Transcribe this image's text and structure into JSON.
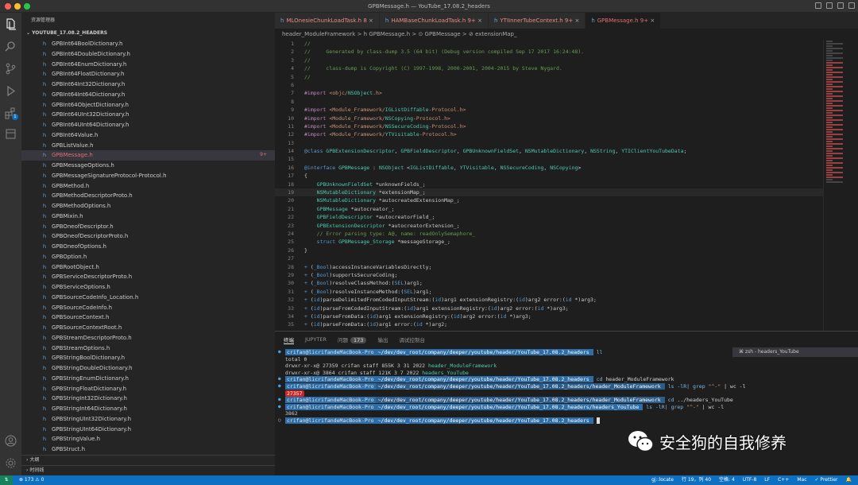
{
  "window": {
    "title": "GPBMessage.h — YouTube_17.08.2_headers"
  },
  "sidebar": {
    "title": "资源管理器",
    "folder": "YOUTUBE_17.08.2_HEADERS",
    "files": [
      "GPBInt64BoolDictionary.h",
      "GPBInt64DoubleDictionary.h",
      "GPBInt64EnumDictionary.h",
      "GPBInt64FloatDictionary.h",
      "GPBInt64Int32Dictionary.h",
      "GPBInt64Int64Dictionary.h",
      "GPBInt64ObjectDictionary.h",
      "GPBInt64UInt32Dictionary.h",
      "GPBInt64UInt64Dictionary.h",
      "GPBInt64Value.h",
      "GPBListValue.h",
      "GPBMessage.h",
      "GPBMessageOptions.h",
      "GPBMessageSignatureProtocol-Protocol.h",
      "GPBMethod.h",
      "GPBMethodDescriptorProto.h",
      "GPBMethodOptions.h",
      "GPBMixin.h",
      "GPBOneofDescriptor.h",
      "GPBOneofDescriptorProto.h",
      "GPBOneofOptions.h",
      "GPBOption.h",
      "GPBRootObject.h",
      "GPBServiceDescriptorProto.h",
      "GPBServiceOptions.h",
      "GPBSourceCodeInfo_Location.h",
      "GPBSourceCodeInfo.h",
      "GPBSourceContext.h",
      "GPBSourceContextRoot.h",
      "GPBStreamDescriptorProto.h",
      "GPBStreamOptions.h",
      "GPBStringBoolDictionary.h",
      "GPBStringDoubleDictionary.h",
      "GPBStringEnumDictionary.h",
      "GPBStringFloatDictionary.h",
      "GPBStringInt32Dictionary.h",
      "GPBStringInt64Dictionary.h",
      "GPBStringUInt32Dictionary.h",
      "GPBStringUInt64Dictionary.h",
      "GPBStringValue.h",
      "GPBStruct.h"
    ],
    "selected_file": "GPBMessage.h",
    "selected_marker": "9+",
    "icon_letter": "h",
    "outline_label": "大纲",
    "timeline_label": "时间线",
    "scm_badge": "1"
  },
  "tabs": [
    {
      "label": "MLOnesieChunkLoadTask.h",
      "marker": "8"
    },
    {
      "label": "HAMBaseChunkLoadTask.h",
      "marker": "9+"
    },
    {
      "label": "YTIInnerTubeContext.h",
      "marker": "9+"
    },
    {
      "label": "GPBMessage.h",
      "marker": "9+"
    }
  ],
  "breadcrumb": "header_ModuleFramework  >  h  GPBMessage.h  >  ⊙ GPBMessage  >  ⊘ extensionMap_",
  "editor": {
    "line_numbers": [
      "1",
      "2",
      "3",
      "4",
      "5",
      "6",
      "7",
      "8",
      "9",
      "10",
      "11",
      "12",
      "13",
      "14",
      "15",
      "16",
      "17",
      "18",
      "19",
      "20",
      "21",
      "22",
      "23",
      "24",
      "25",
      "26",
      "27",
      "28",
      "29",
      "30",
      "31",
      "32",
      "33",
      "34",
      "35"
    ],
    "lines": [
      "//",
      "//     Generated by class-dump 3.5 (64 bit) (Debug version compiled Sep 17 2017 16:24:48).",
      "//",
      "//     class-dump is Copyright (C) 1997-1998, 2000-2001, 2004-2015 by Steve Nygard.",
      "//",
      "",
      "#import <objc/NSObject.h>",
      "",
      "#import <Module_Framework/IGListDiffable-Protocol.h>",
      "#import <Module_Framework/NSCopying-Protocol.h>",
      "#import <Module_Framework/NSSecureCoding-Protocol.h>",
      "#import <Module_Framework/YTVisitable-Protocol.h>",
      "",
      "@class GPBExtensionDescriptor, GPBFieldDescriptor, GPBUnknownFieldSet, NSMutableDictionary, NSString, YTIClientYouTubeData;",
      "",
      "@interface GPBMessage : NSObject <IGListDiffable, YTVisitable, NSSecureCoding, NSCopying>",
      "{",
      "    GPBUnknownFieldSet *unknownFields_;",
      "    NSMutableDictionary *extensionMap_;",
      "    NSMutableDictionary *autocreatedExtensionMap_;",
      "    GPBMessage *autocreator_;",
      "    GPBFieldDescriptor *autocreatorField_;",
      "    GPBExtensionDescriptor *autocreatorExtension_;",
      "    // Error parsing type: A@, name: readOnlySemaphore_",
      "    struct GPBMessage_Storage *messageStorage_;",
      "}",
      "",
      "+ (_Bool)accessInstanceVariablesDirectly;",
      "+ (_Bool)supportsSecureCoding;",
      "+ (_Bool)resolveClassMethod:(SEL)arg1;",
      "+ (_Bool)resolveInstanceMethod:(SEL)arg1;",
      "+ (id)parseDelimitedFromCodedInputStream:(id)arg1 extensionRegistry:(id)arg2 error:(id *)arg3;",
      "+ (id)parseFromCodedInputStream:(id)arg1 extensionRegistry:(id)arg2 error:(id *)arg3;",
      "+ (id)parseFromData:(id)arg1 extensionRegistry:(id)arg2 error:(id *)arg3;",
      "+ (id)parseFromData:(id)arg1 error:(id *)arg2;"
    ]
  },
  "panel": {
    "tabs": [
      "终端",
      "JUPYTER",
      "问题",
      "输出",
      "调试控制台"
    ],
    "problems_count": "173",
    "terminal_instance": "zsh - headers_YouTube",
    "prompt_user": "crifan@licrifandeMacBook-Pro",
    "path_root": "~/dev/dev_root/company/deeper/youtube/header/YouTube_17.08.2_headers",
    "path_module": "~/dev/dev_root/company/deeper/youtube/header/YouTube_17.08.2_headers/header_ModuleFramework",
    "path_yt": "~/dev/dev_root/company/deeper/youtube/header/YouTube_17.08.2_headers/headers_YouTube",
    "cmd_ll": "ll",
    "total": "total 0",
    "dir1_prefix": "drwxr-xr-x@ 27359 crifan  staff   855K  3 31  2022",
    "dir1_name": "header_ModuleFramework",
    "dir2_prefix": "drwxr-xr-x@  3864 crifan  staff   121K  3  7  2022",
    "dir2_name": "headers_YouTube",
    "cmd_cd1_a": "cd",
    "cmd_cd1_b": "header_ModuleFramework",
    "cmd_ls_a": "ls",
    "cmd_ls_b": "-lR|",
    "cmd_ls_c": "grep",
    "cmd_ls_d": "\"^-\"",
    "cmd_ls_e": "| wc -l",
    "count1": "27357",
    "cmd_cd2_a": "cd",
    "cmd_cd2_b": "../headers_YouTube",
    "count2": "3862",
    "dot_green": "●",
    "dot_blue": "●",
    "dot_empty": "○"
  },
  "watermark": {
    "text": "安全狗的自我修养"
  },
  "status": {
    "errors": "⊗ 173 ⚠ 0",
    "branch": "gj::locate",
    "position": "行 19，列 40",
    "spaces": "空格: 4",
    "encoding": "UTF-8",
    "eol": "LF",
    "language": "C++",
    "platform": "Mac",
    "formatter": "✓ Prettier"
  },
  "colors": {
    "accent": "#0e70c0",
    "error_red": "#e06c75",
    "prompt_blue": "#2e6ea8"
  }
}
